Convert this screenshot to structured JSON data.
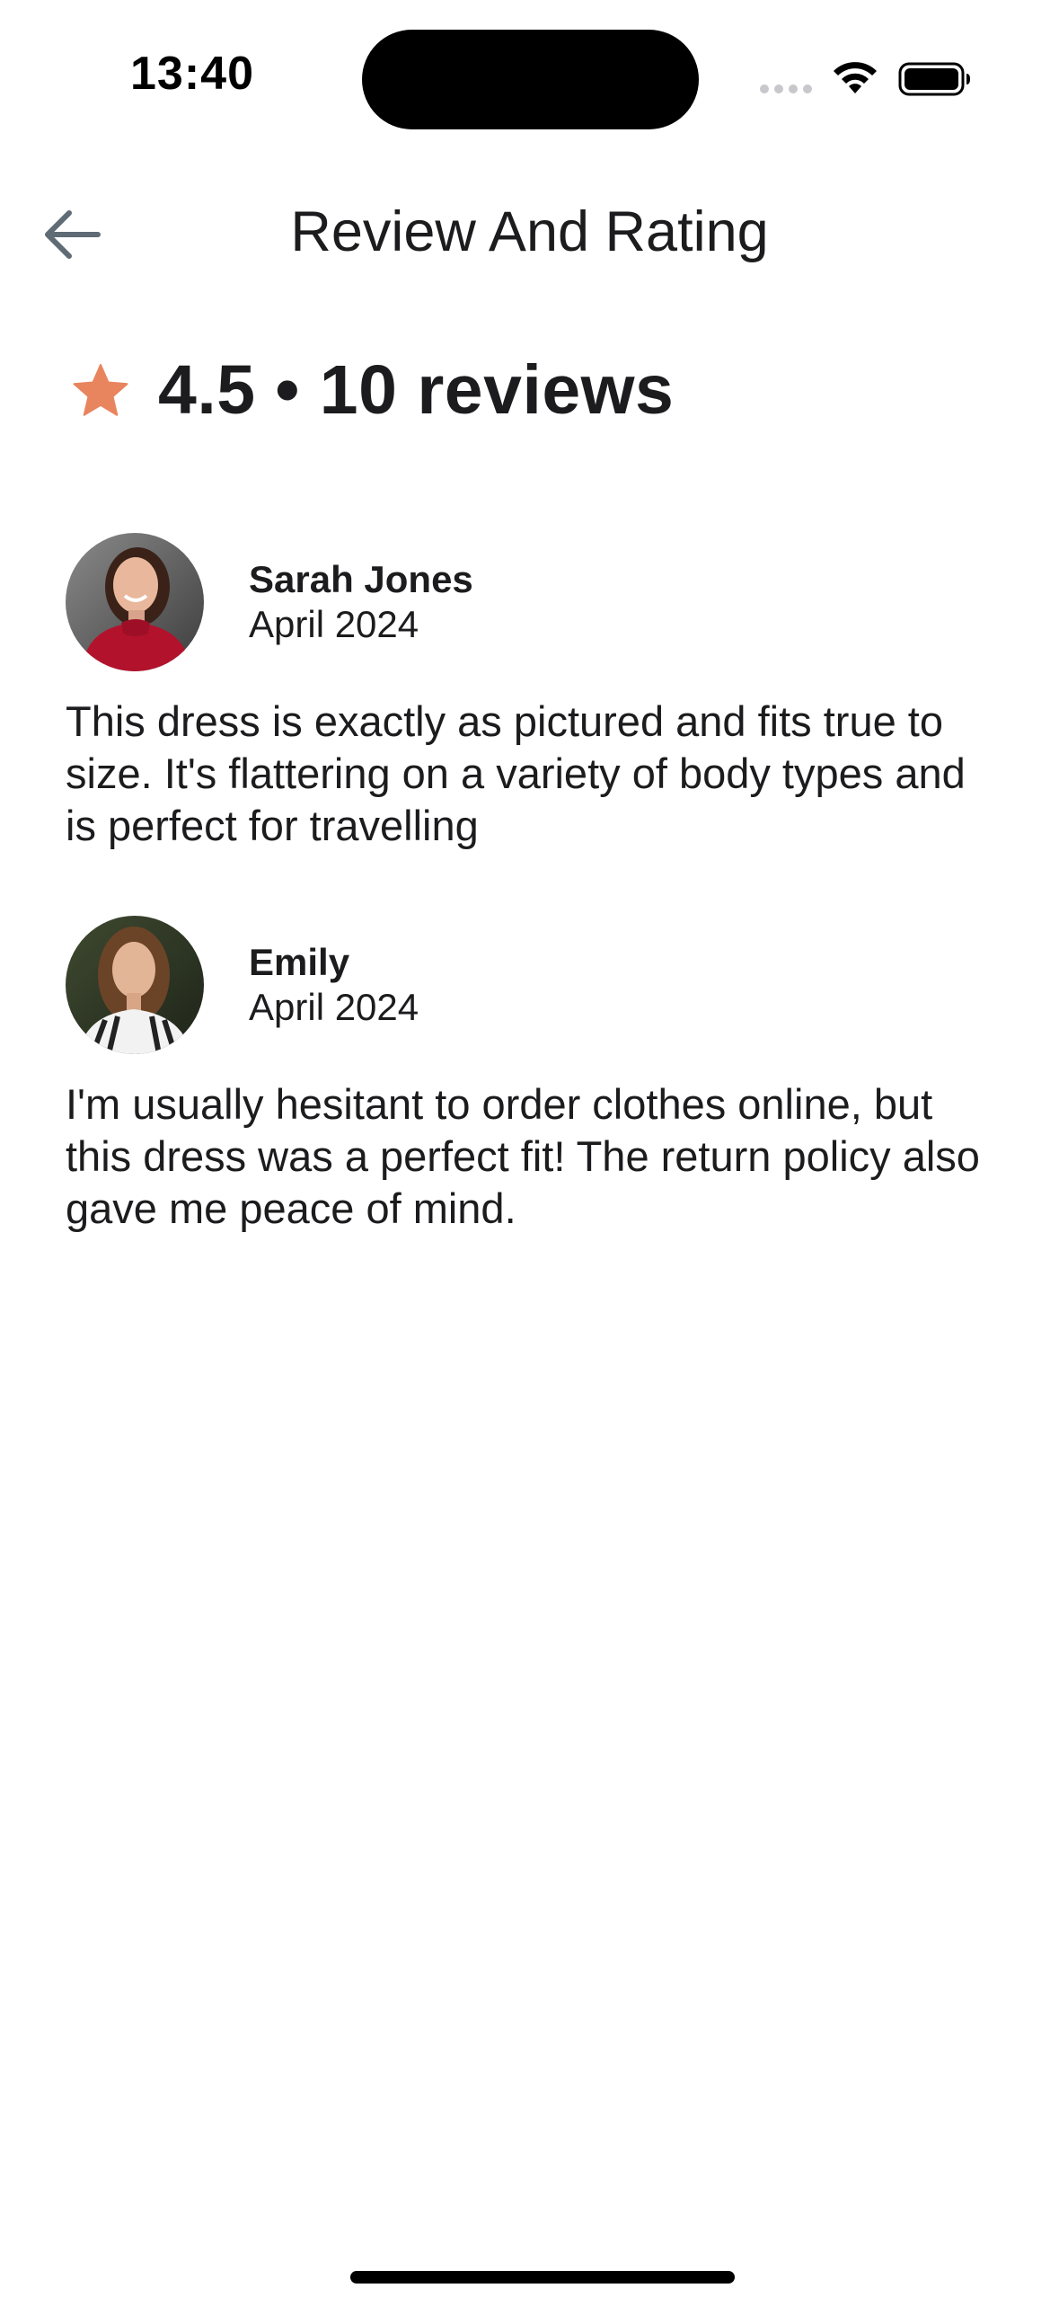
{
  "status_bar": {
    "time": "13:40",
    "icons": [
      "cellular-signal-icon",
      "wifi-icon",
      "battery-icon"
    ]
  },
  "header": {
    "title": "Review And Rating",
    "back_icon": "arrow-left-icon"
  },
  "rating_summary": {
    "icon": "star-icon",
    "text": "4.5 • 10 reviews",
    "star_color": "#E8845E"
  },
  "reviews": [
    {
      "name": "Sarah Jones",
      "date": "April 2024",
      "text": "This dress is exactly as pictured and fits true to size. It's flattering on a variety of body types and is perfect for travelling"
    },
    {
      "name": "Emily",
      "date": "April 2024",
      "text": "I'm usually hesitant to order clothes online, but this dress was a perfect fit! The return policy also gave me peace of mind."
    }
  ]
}
